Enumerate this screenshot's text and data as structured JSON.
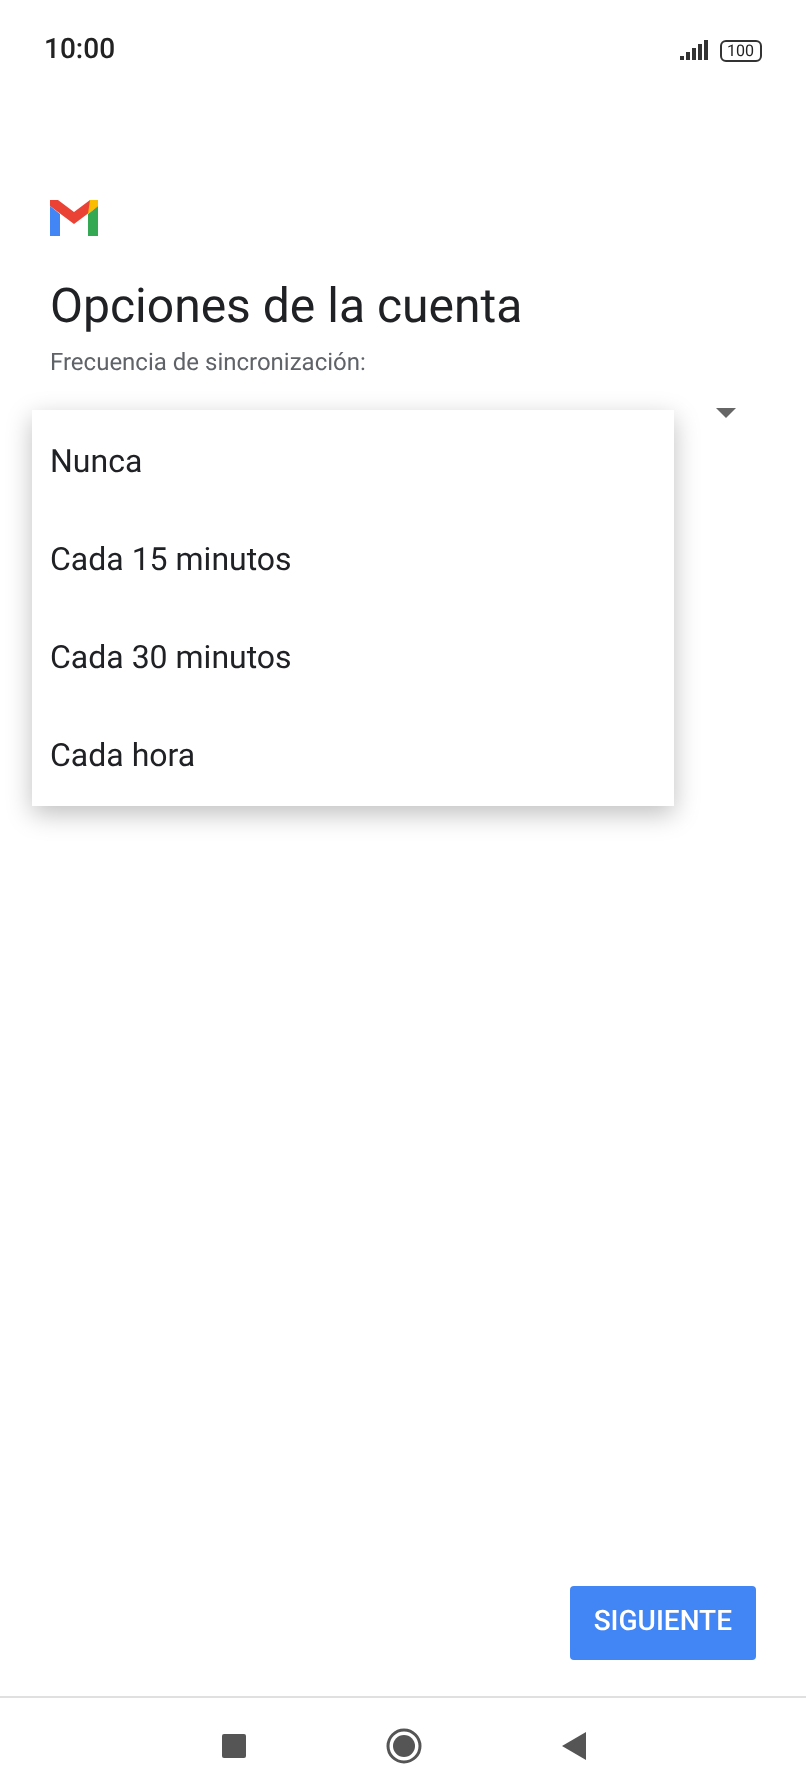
{
  "status_bar": {
    "time": "10:00",
    "battery": "100"
  },
  "title": "Opciones de la cuenta",
  "sync_field": {
    "label": "Frecuencia de sincronización:"
  },
  "menu": {
    "items": [
      {
        "label": "Nunca"
      },
      {
        "label": "Cada 15 minutos"
      },
      {
        "label": "Cada 30 minutos"
      },
      {
        "label": "Cada hora"
      }
    ]
  },
  "next_button": "SIGUIENTE"
}
